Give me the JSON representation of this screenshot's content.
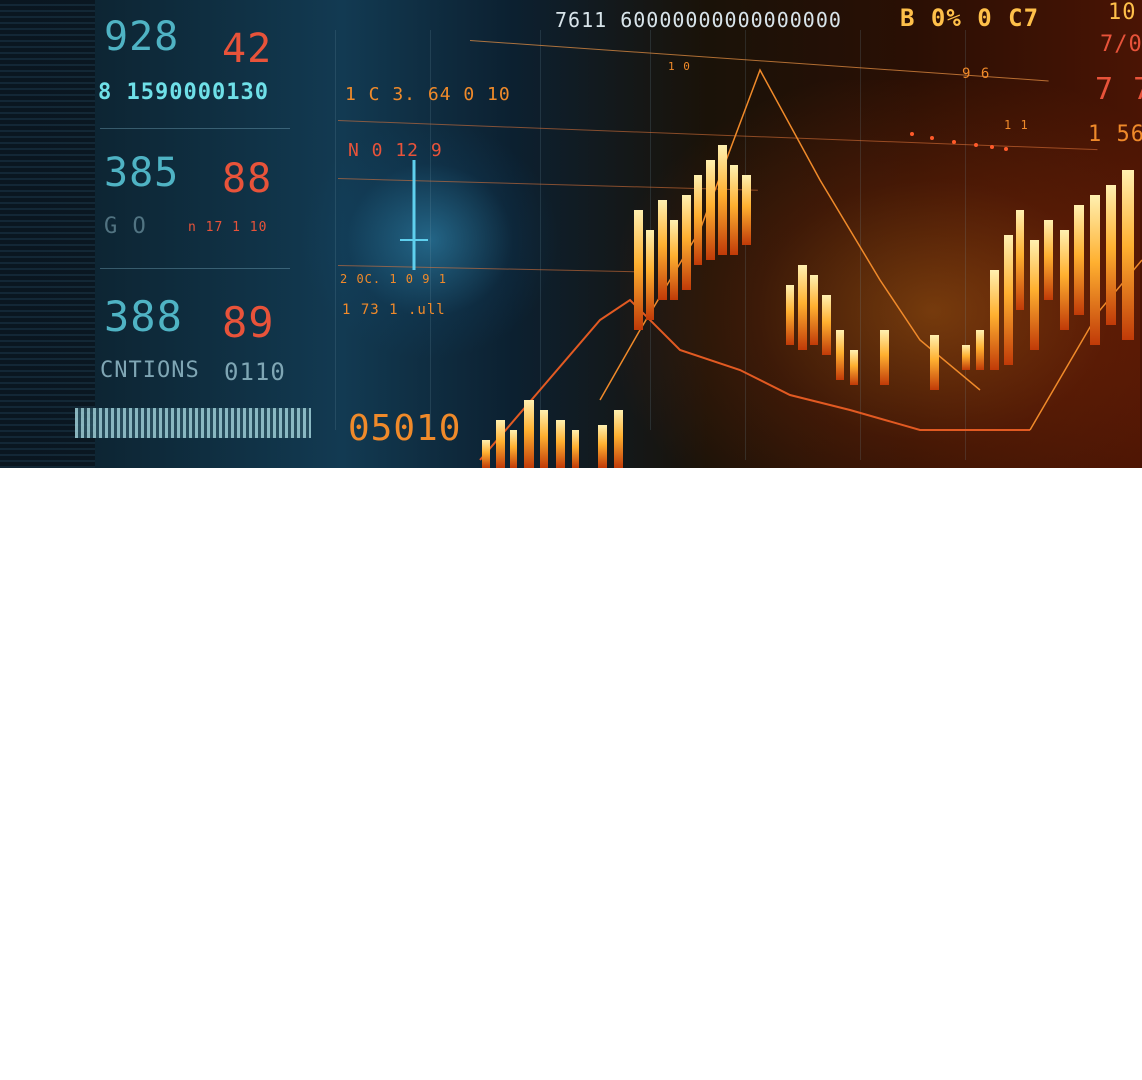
{
  "image": {
    "readouts": {
      "top_left_a": "928",
      "top_left_b": "42",
      "row2": "8 1590000130",
      "mid_a": "385",
      "mid_b": "88",
      "row4_a": "G O",
      "row4_b": "n  17 1 10",
      "low_a": "388",
      "low_b": "89",
      "label_left": "CNTIONS",
      "label_left_val": "0110",
      "big_bottom": "05010"
    },
    "center_labels": {
      "row1": "1 C 3. 64  0 10",
      "row2": "N   0  12  9",
      "row3": "2  0C.  1  0  9  1",
      "row4": "1  73   1  .ull"
    },
    "top_strip": {
      "ticker": "7611 60000000000000000",
      "right_code": "B 0% 0 C7",
      "far_right_a": "10",
      "far_right_b": "7/0",
      "far_right_c": "7 7",
      "far_right_d": "1 56",
      "small_a": "9 6",
      "small_b": "1 1",
      "small_c": "1 0"
    },
    "colors": {
      "teal": "#4fb3c4",
      "red": "#e8533a",
      "orange": "#f08a2a",
      "amber": "#ffc04a",
      "background_left": "#0f2e40",
      "background_right": "#4a1404"
    }
  }
}
